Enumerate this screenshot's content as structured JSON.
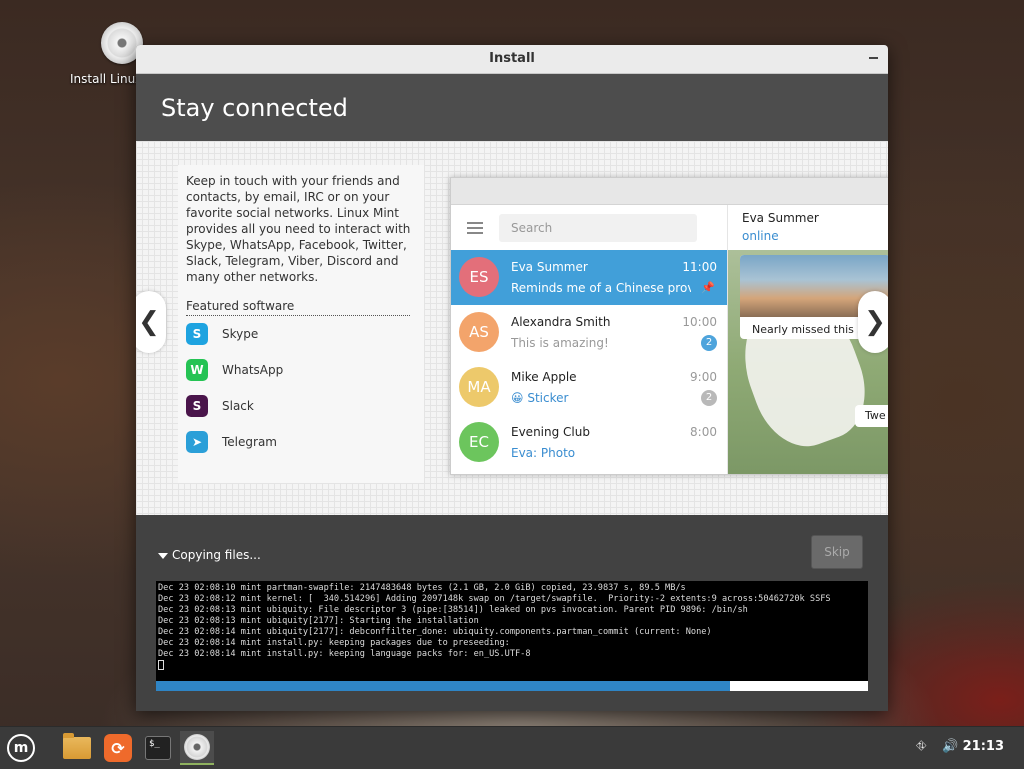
{
  "desktop": {
    "icon_label": "Install Linux Mint"
  },
  "window": {
    "title": "Install",
    "heading": "Stay connected",
    "intro": "Keep in touch with your friends and contacts, by email, IRC or on your favorite social networks. Linux Mint provides all you need to interact with Skype, WhatsApp, Facebook, Twitter, Slack, Telegram, Viber, Discord and many other networks.",
    "featured_title": "Featured software",
    "featured": [
      {
        "label": "Skype",
        "color": "#1ea3e0",
        "glyph": "S"
      },
      {
        "label": "WhatsApp",
        "color": "#25c354",
        "glyph": "W"
      },
      {
        "label": "Slack",
        "color": "#4a154b",
        "glyph": "S"
      },
      {
        "label": "Telegram",
        "color": "#2b9fd8",
        "glyph": "➤"
      }
    ],
    "telegram": {
      "search_placeholder": "Search",
      "contact_name": "Eva Summer",
      "contact_status": "online",
      "photo_caption": "Nearly missed this s",
      "tweet": "Twe",
      "chats": [
        {
          "initials": "ES",
          "name": "Eva Summer",
          "time": "11:00",
          "message": "Reminds me of a Chinese prover...",
          "avatar_color": "#e36f7a",
          "badge": "",
          "active": true
        },
        {
          "initials": "AS",
          "name": "Alexandra Smith",
          "time": "10:00",
          "message": "This is amazing!",
          "avatar_color": "#f3a46b",
          "badge": "2",
          "active": false
        },
        {
          "initials": "MA",
          "name": "Mike Apple",
          "time": "9:00",
          "message": "😀 Sticker",
          "avatar_color": "#edc96b",
          "badge": "2",
          "active": false
        },
        {
          "initials": "EC",
          "name": "Evening Club",
          "time": "8:00",
          "message": "Eva: Photo",
          "avatar_color": "#6cc55d",
          "badge": "",
          "active": false
        }
      ]
    },
    "nav": {
      "prev": "❮",
      "next": "❯"
    },
    "status": "Copying files...",
    "skip_label": "Skip",
    "log": [
      "Dec 23 02:08:10 mint partman-swapfile: 2147483648 bytes (2.1 GB, 2.0 GiB) copied, 23.9837 s, 89.5 MB/s",
      "Dec 23 02:08:12 mint kernel: [  340.514296] Adding 2097148k swap on /target/swapfile.  Priority:-2 extents:9 across:50462720k SSFS",
      "Dec 23 02:08:13 mint ubiquity: File descriptor 3 (pipe:[38514]) leaked on pvs invocation. Parent PID 9896: /bin/sh",
      "Dec 23 02:08:13 mint ubiquity[2177]: Starting the installation",
      "Dec 23 02:08:14 mint ubiquity[2177]: debconffilter_done: ubiquity.components.partman_commit (current: None)",
      "Dec 23 02:08:14 mint install.py: keeping packages due to preseeding:",
      "Dec 23 02:08:14 mint install.py: keeping language packs for: en_US.UTF-8"
    ],
    "progress": 0.806
  },
  "taskbar": {
    "items": [
      "mint-menu-icon",
      "files-icon",
      "firefox-icon",
      "terminal-icon",
      "installer-disc-icon"
    ],
    "clock": "21:13"
  }
}
